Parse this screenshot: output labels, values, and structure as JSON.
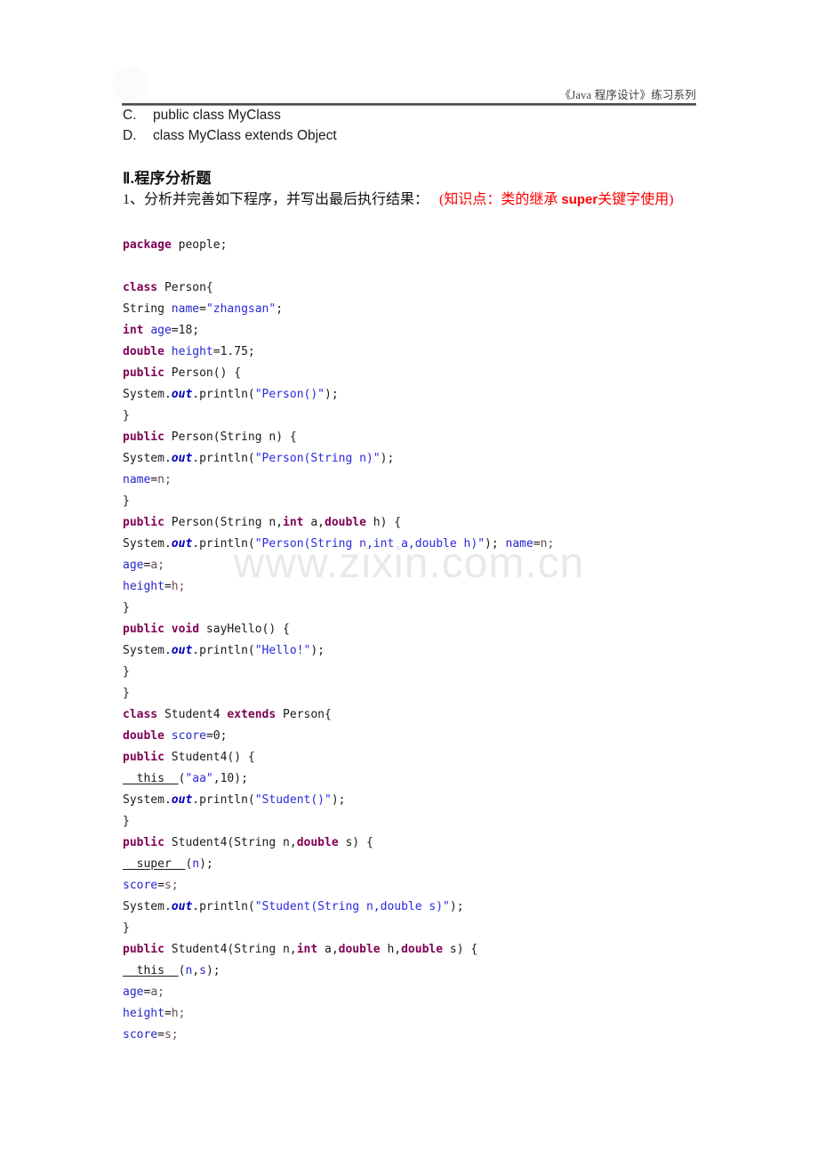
{
  "document": {
    "header_text": "《Java 程序设计》练习系列",
    "watermark": "www.zixin.com.cn"
  },
  "options": [
    {
      "key": "C.",
      "text": "public class MyClass"
    },
    {
      "key": "D.",
      "text": "class MyClass extends Object"
    }
  ],
  "section": {
    "heading": "Ⅱ.程序分析题",
    "question_prefix": "1、分析并完善如下程序，并写出最后执行结果：",
    "question_note_1": "(知识点：类的继承",
    "question_note_latin": "super",
    "question_note_2": "关键字使用)"
  },
  "code": {
    "lines": [
      {
        "id": "l01",
        "tokens": [
          {
            "t": "package",
            "c": "kw"
          },
          {
            "t": " people;",
            "c": "pln"
          }
        ]
      },
      {
        "id": "l02",
        "tokens": [
          {
            "t": " ",
            "c": "pln"
          }
        ]
      },
      {
        "id": "l03",
        "tokens": [
          {
            "t": "class",
            "c": "kw"
          },
          {
            "t": " Person{",
            "c": "pln"
          }
        ]
      },
      {
        "id": "l04",
        "tokens": [
          {
            "t": "String ",
            "c": "pln"
          },
          {
            "t": "name",
            "c": "var"
          },
          {
            "t": "=",
            "c": "pln"
          },
          {
            "t": "\"zhangsan\"",
            "c": "str"
          },
          {
            "t": ";",
            "c": "pln"
          }
        ]
      },
      {
        "id": "l05",
        "tokens": [
          {
            "t": "int",
            "c": "kw"
          },
          {
            "t": " ",
            "c": "pln"
          },
          {
            "t": "age",
            "c": "var"
          },
          {
            "t": "=18;",
            "c": "pln"
          }
        ]
      },
      {
        "id": "l06",
        "tokens": [
          {
            "t": "double",
            "c": "kw"
          },
          {
            "t": " ",
            "c": "pln"
          },
          {
            "t": "height",
            "c": "var"
          },
          {
            "t": "=1.75;",
            "c": "pln"
          }
        ]
      },
      {
        "id": "l07",
        "tokens": [
          {
            "t": "public",
            "c": "kw"
          },
          {
            "t": " Person() {",
            "c": "pln"
          }
        ]
      },
      {
        "id": "l08",
        "tokens": [
          {
            "t": "System.",
            "c": "pln"
          },
          {
            "t": "out",
            "c": "stat"
          },
          {
            "t": ".println(",
            "c": "pln"
          },
          {
            "t": "\"Person()\"",
            "c": "str"
          },
          {
            "t": ");",
            "c": "pln"
          }
        ]
      },
      {
        "id": "l09",
        "tokens": [
          {
            "t": "}",
            "c": "pln"
          }
        ]
      },
      {
        "id": "l10",
        "tokens": [
          {
            "t": "public",
            "c": "kw"
          },
          {
            "t": " Person(String n) {",
            "c": "pln"
          }
        ]
      },
      {
        "id": "l11",
        "tokens": [
          {
            "t": "System.",
            "c": "pln"
          },
          {
            "t": "out",
            "c": "stat"
          },
          {
            "t": ".println(",
            "c": "pln"
          },
          {
            "t": "\"Person(String n)\"",
            "c": "str"
          },
          {
            "t": ");",
            "c": "pln"
          }
        ]
      },
      {
        "id": "l12",
        "tokens": [
          {
            "t": "name",
            "c": "var"
          },
          {
            "t": "=",
            "c": "pln"
          },
          {
            "t": "n;",
            "c": "dim"
          }
        ]
      },
      {
        "id": "l13",
        "tokens": [
          {
            "t": "}",
            "c": "pln"
          }
        ]
      },
      {
        "id": "l14",
        "tokens": [
          {
            "t": "public",
            "c": "kw"
          },
          {
            "t": " Person(String n,",
            "c": "pln"
          },
          {
            "t": "int",
            "c": "kw"
          },
          {
            "t": " a,",
            "c": "pln"
          },
          {
            "t": "double",
            "c": "kw"
          },
          {
            "t": " h) {",
            "c": "pln"
          }
        ]
      },
      {
        "id": "l15",
        "tokens": [
          {
            "t": "System.",
            "c": "pln"
          },
          {
            "t": "out",
            "c": "stat"
          },
          {
            "t": ".println(",
            "c": "pln"
          },
          {
            "t": "\"Person(String n,int a,double h)\"",
            "c": "str"
          },
          {
            "t": "); ",
            "c": "pln"
          },
          {
            "t": "name",
            "c": "var"
          },
          {
            "t": "=",
            "c": "pln"
          },
          {
            "t": "n;",
            "c": "dim"
          }
        ]
      },
      {
        "id": "l16",
        "tokens": [
          {
            "t": "age",
            "c": "var"
          },
          {
            "t": "=",
            "c": "pln"
          },
          {
            "t": "a;",
            "c": "dim"
          }
        ]
      },
      {
        "id": "l17",
        "tokens": [
          {
            "t": "height",
            "c": "var"
          },
          {
            "t": "=",
            "c": "pln"
          },
          {
            "t": "h;",
            "c": "dim"
          }
        ]
      },
      {
        "id": "l18",
        "tokens": [
          {
            "t": "}",
            "c": "pln"
          }
        ]
      },
      {
        "id": "l19",
        "tokens": [
          {
            "t": "public",
            "c": "kw"
          },
          {
            "t": " ",
            "c": "pln"
          },
          {
            "t": "void",
            "c": "kw"
          },
          {
            "t": " sayHello() {",
            "c": "pln"
          }
        ]
      },
      {
        "id": "l20",
        "tokens": [
          {
            "t": "System.",
            "c": "pln"
          },
          {
            "t": "out",
            "c": "stat"
          },
          {
            "t": ".println(",
            "c": "pln"
          },
          {
            "t": "\"Hello!\"",
            "c": "str"
          },
          {
            "t": ");",
            "c": "pln"
          }
        ]
      },
      {
        "id": "l21",
        "tokens": [
          {
            "t": "}",
            "c": "pln"
          }
        ]
      },
      {
        "id": "l22",
        "tokens": [
          {
            "t": "}",
            "c": "pln"
          }
        ]
      },
      {
        "id": "l23",
        "tokens": [
          {
            "t": "class",
            "c": "kw"
          },
          {
            "t": " Student4 ",
            "c": "pln"
          },
          {
            "t": "extends",
            "c": "kw"
          },
          {
            "t": " Person{",
            "c": "pln"
          }
        ]
      },
      {
        "id": "l24",
        "tokens": [
          {
            "t": "double",
            "c": "kw"
          },
          {
            "t": " ",
            "c": "pln"
          },
          {
            "t": "score",
            "c": "var"
          },
          {
            "t": "=0;",
            "c": "pln"
          }
        ]
      },
      {
        "id": "l25",
        "tokens": [
          {
            "t": "public",
            "c": "kw"
          },
          {
            "t": " Student4() {",
            "c": "pln"
          }
        ]
      },
      {
        "id": "l26",
        "tokens": [
          {
            "t": "  this  ",
            "c": "blank-fill"
          },
          {
            "t": "(",
            "c": "pln"
          },
          {
            "t": "\"aa\"",
            "c": "str"
          },
          {
            "t": ",10);",
            "c": "pln"
          }
        ]
      },
      {
        "id": "l27",
        "tokens": [
          {
            "t": "System.",
            "c": "pln"
          },
          {
            "t": "out",
            "c": "stat"
          },
          {
            "t": ".println(",
            "c": "pln"
          },
          {
            "t": "\"Student()\"",
            "c": "str"
          },
          {
            "t": ");",
            "c": "pln"
          }
        ]
      },
      {
        "id": "l28",
        "tokens": [
          {
            "t": "}",
            "c": "pln"
          }
        ]
      },
      {
        "id": "l29",
        "tokens": [
          {
            "t": "public",
            "c": "kw"
          },
          {
            "t": " Student4(String n,",
            "c": "pln"
          },
          {
            "t": "double",
            "c": "kw"
          },
          {
            "t": " s) {",
            "c": "pln"
          }
        ]
      },
      {
        "id": "l30",
        "tokens": [
          {
            "t": "  super  ",
            "c": "blank-fill"
          },
          {
            "t": "(",
            "c": "pln"
          },
          {
            "t": "n",
            "c": "var"
          },
          {
            "t": ");",
            "c": "pln"
          }
        ]
      },
      {
        "id": "l31",
        "tokens": [
          {
            "t": "score",
            "c": "var"
          },
          {
            "t": "=",
            "c": "pln"
          },
          {
            "t": "s;",
            "c": "dim"
          }
        ]
      },
      {
        "id": "l32",
        "tokens": [
          {
            "t": "System.",
            "c": "pln"
          },
          {
            "t": "out",
            "c": "stat"
          },
          {
            "t": ".println(",
            "c": "pln"
          },
          {
            "t": "\"Student(String n,double s)\"",
            "c": "str"
          },
          {
            "t": ");",
            "c": "pln"
          }
        ]
      },
      {
        "id": "l33",
        "tokens": [
          {
            "t": "}",
            "c": "pln"
          }
        ]
      },
      {
        "id": "l34",
        "tokens": [
          {
            "t": "public",
            "c": "kw"
          },
          {
            "t": " Student4(String n,",
            "c": "pln"
          },
          {
            "t": "int",
            "c": "kw"
          },
          {
            "t": " a,",
            "c": "pln"
          },
          {
            "t": "double",
            "c": "kw"
          },
          {
            "t": " h,",
            "c": "pln"
          },
          {
            "t": "double",
            "c": "kw"
          },
          {
            "t": " s) {",
            "c": "pln"
          }
        ]
      },
      {
        "id": "l35",
        "tokens": [
          {
            "t": "  this  ",
            "c": "blank-fill"
          },
          {
            "t": "(",
            "c": "pln"
          },
          {
            "t": "n",
            "c": "var"
          },
          {
            "t": ",",
            "c": "pln"
          },
          {
            "t": "s",
            "c": "var"
          },
          {
            "t": ");",
            "c": "pln"
          }
        ]
      },
      {
        "id": "l36",
        "tokens": [
          {
            "t": "age",
            "c": "var"
          },
          {
            "t": "=",
            "c": "pln"
          },
          {
            "t": "a;",
            "c": "dim"
          }
        ]
      },
      {
        "id": "l37",
        "tokens": [
          {
            "t": "height",
            "c": "var"
          },
          {
            "t": "=",
            "c": "pln"
          },
          {
            "t": "h;",
            "c": "dim"
          }
        ]
      },
      {
        "id": "l38",
        "tokens": [
          {
            "t": "score",
            "c": "var"
          },
          {
            "t": "=",
            "c": "pln"
          },
          {
            "t": "s;",
            "c": "dim"
          }
        ]
      }
    ]
  }
}
